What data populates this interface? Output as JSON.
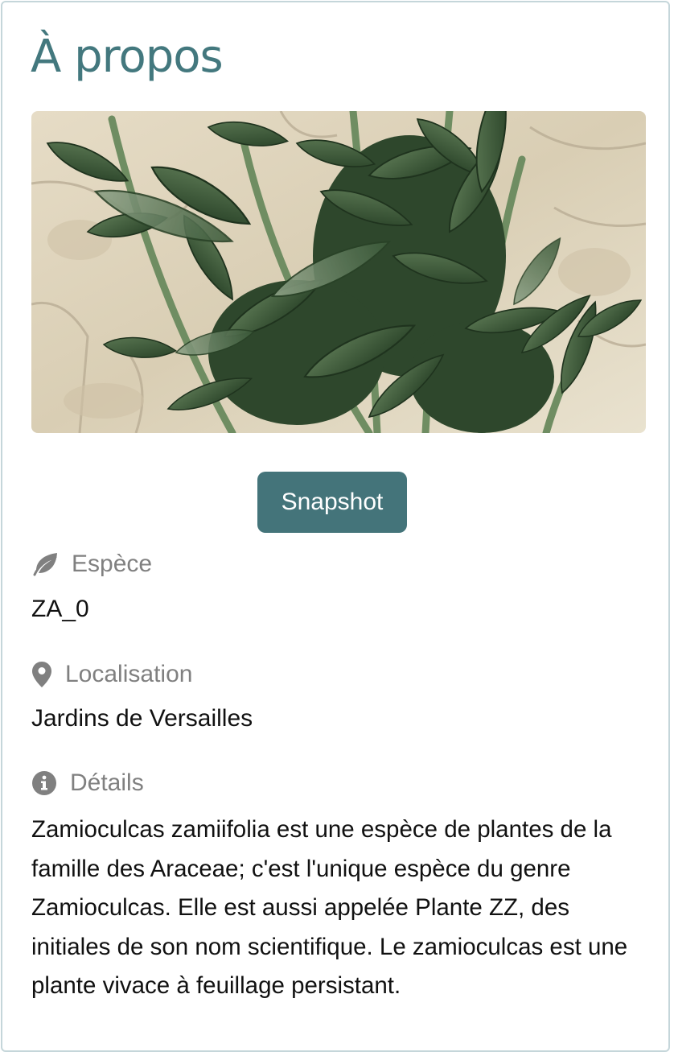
{
  "about": {
    "title": "À propos",
    "image_alt": "Plante Zamioculcas zamiifolia"
  },
  "actions": {
    "snapshot_label": "Snapshot"
  },
  "species": {
    "icon": "leaf-icon",
    "label": "Espèce",
    "value": "ZA_0"
  },
  "location": {
    "icon": "map-marker-icon",
    "label": "Localisation",
    "value": "Jardins de Versailles"
  },
  "details": {
    "icon": "info-circle-icon",
    "label": "Détails",
    "text": "Zamioculcas zamiifolia est une espèce de plantes de la famille des Araceae; c'est l'unique espèce du genre Zamioculcas. Elle est aussi appelée Plante ZZ, des initiales de son nom scientifique. Le zamioculcas est une plante vivace à feuillage persistant."
  },
  "colors": {
    "accent": "#43787e",
    "button": "#44747a",
    "label": "#808080",
    "border": "#c5d6da"
  }
}
